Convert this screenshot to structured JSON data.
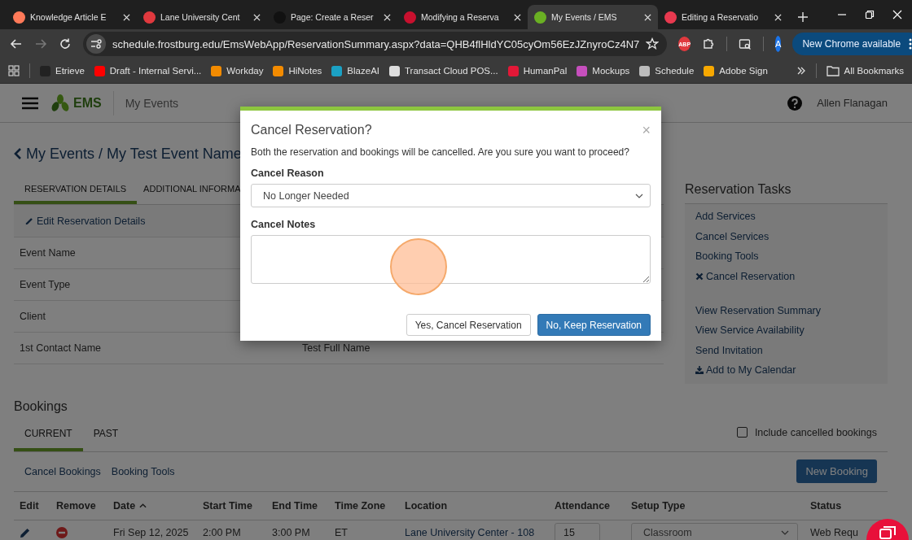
{
  "browser": {
    "tabs": [
      {
        "title": "Knowledge Article E",
        "selected": false
      },
      {
        "title": "Lane University Cent",
        "selected": false
      },
      {
        "title": "Page: Create a Reser",
        "selected": false
      },
      {
        "title": "Modifying a Reserva",
        "selected": false
      },
      {
        "title": "My Events / EMS",
        "selected": true
      },
      {
        "title": "Editing a Reservatio",
        "selected": false
      }
    ],
    "address": "schedule.frostburg.edu/EmsWebApp/ReservationSummary.aspx?data=QHB4flHldYC05cyOm56EzJZnyroCz4N7",
    "extension_badge": "ABP",
    "profile_initial": "A",
    "update_button": "New Chrome available",
    "bookmarks": [
      "Etrieve",
      "Draft - Internal Servi...",
      "Workday",
      "HiNotes",
      "BlazeAI",
      "Transact Cloud POS...",
      "HumanPal",
      "Mockups",
      "Schedule",
      "Adobe Sign"
    ],
    "all_bookmarks": "All Bookmarks"
  },
  "app": {
    "logo": "EMS",
    "section": "My Events",
    "user": "Allen Flanagan"
  },
  "breadcrumb": {
    "parent": "My Events",
    "separator": "/",
    "current": "My Test Event Name"
  },
  "detail_tabs": [
    {
      "label": "RESERVATION DETAILS",
      "selected": true
    },
    {
      "label": "ADDITIONAL INFORMA",
      "selected": false
    }
  ],
  "edit_link": "Edit Reservation Details",
  "details": [
    {
      "label": "Event Name"
    },
    {
      "label": "Event Type"
    },
    {
      "label": "Client"
    },
    {
      "label": "1st Contact Name",
      "value": "Test Full Name"
    }
  ],
  "tasks": {
    "title": "Reservation Tasks",
    "groups": [
      {
        "items": [
          {
            "label": "Add Services",
            "kind": "link"
          },
          {
            "label": "Cancel Services",
            "kind": "link"
          },
          {
            "label": "Booking Tools",
            "kind": "link"
          },
          {
            "label": "Cancel Reservation",
            "kind": "cancel"
          }
        ]
      },
      {
        "items": [
          {
            "label": "View Reservation Summary",
            "kind": "link"
          },
          {
            "label": "View Service Availability",
            "kind": "link"
          },
          {
            "label": "Send Invitation",
            "kind": "link"
          },
          {
            "label": "Add to My Calendar",
            "kind": "download"
          }
        ]
      }
    ]
  },
  "bookings": {
    "title": "Bookings",
    "tabs": [
      {
        "label": "CURRENT",
        "selected": true
      },
      {
        "label": "PAST",
        "selected": false
      }
    ],
    "include_cancelled": {
      "label": "Include cancelled bookings",
      "checked": false
    },
    "actions": [
      "Cancel Bookings",
      "Booking Tools"
    ],
    "new_button": "New Booking",
    "columns": [
      {
        "label": "Edit",
        "sorted": false
      },
      {
        "label": "Remove",
        "sorted": false
      },
      {
        "label": "Date",
        "sorted": true
      },
      {
        "label": "Start Time",
        "sorted": false
      },
      {
        "label": "End Time",
        "sorted": false
      },
      {
        "label": "Time Zone",
        "sorted": false
      },
      {
        "label": "Location",
        "sorted": false
      },
      {
        "label": "Attendance",
        "sorted": false
      },
      {
        "label": "Setup Type",
        "sorted": false
      },
      {
        "label": "Status",
        "sorted": false
      }
    ],
    "rows": [
      {
        "date": "Fri Sep 12, 2025",
        "start": "2:00 PM",
        "end": "3:00 PM",
        "zone": "ET",
        "location": "Lane University Center - 108",
        "attendance": "15",
        "setup": "Classroom",
        "status": "Web Requ"
      }
    ]
  },
  "modal": {
    "title": "Cancel Reservation?",
    "close": "×",
    "message": "Both the reservation and bookings will be cancelled. Are you sure you want to proceed?",
    "reason_label": "Cancel Reason",
    "reason": "No Longer Needed",
    "notes_label": "Cancel Notes",
    "buttons": [
      {
        "label": "Yes, Cancel Reservation",
        "kind": "default"
      },
      {
        "label": "No, Keep Reservation",
        "kind": "primary"
      }
    ]
  }
}
